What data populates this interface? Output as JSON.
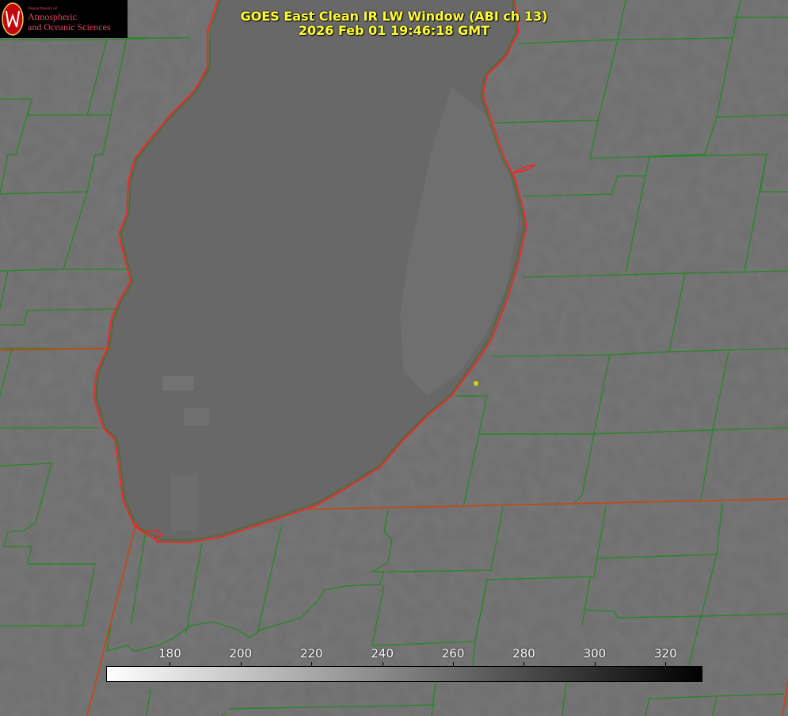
{
  "logo": {
    "dept": "Department of",
    "line1": "Atmospheric",
    "line2": "and Oceanic Sciences",
    "seal_icon": "uw-crest-icon"
  },
  "title": {
    "line1": "GOES East Clean IR LW Window (ABI ch 13)",
    "line2": "2026 Feb 01 19:46:18 GMT"
  },
  "colorbar": {
    "min": 162,
    "max": 330,
    "ticks": [
      "180",
      "200",
      "220",
      "240",
      "260",
      "280",
      "300",
      "320"
    ],
    "color_low": "#ffffff",
    "color_high": "#000000"
  },
  "colors": {
    "lake": "#6a6a6a",
    "land": "#6e6e6e",
    "county_lines": "#1f8a1f",
    "shoreline_red": "#ff2020",
    "state_line": "#c04a1a",
    "marker": "#d4d400"
  }
}
